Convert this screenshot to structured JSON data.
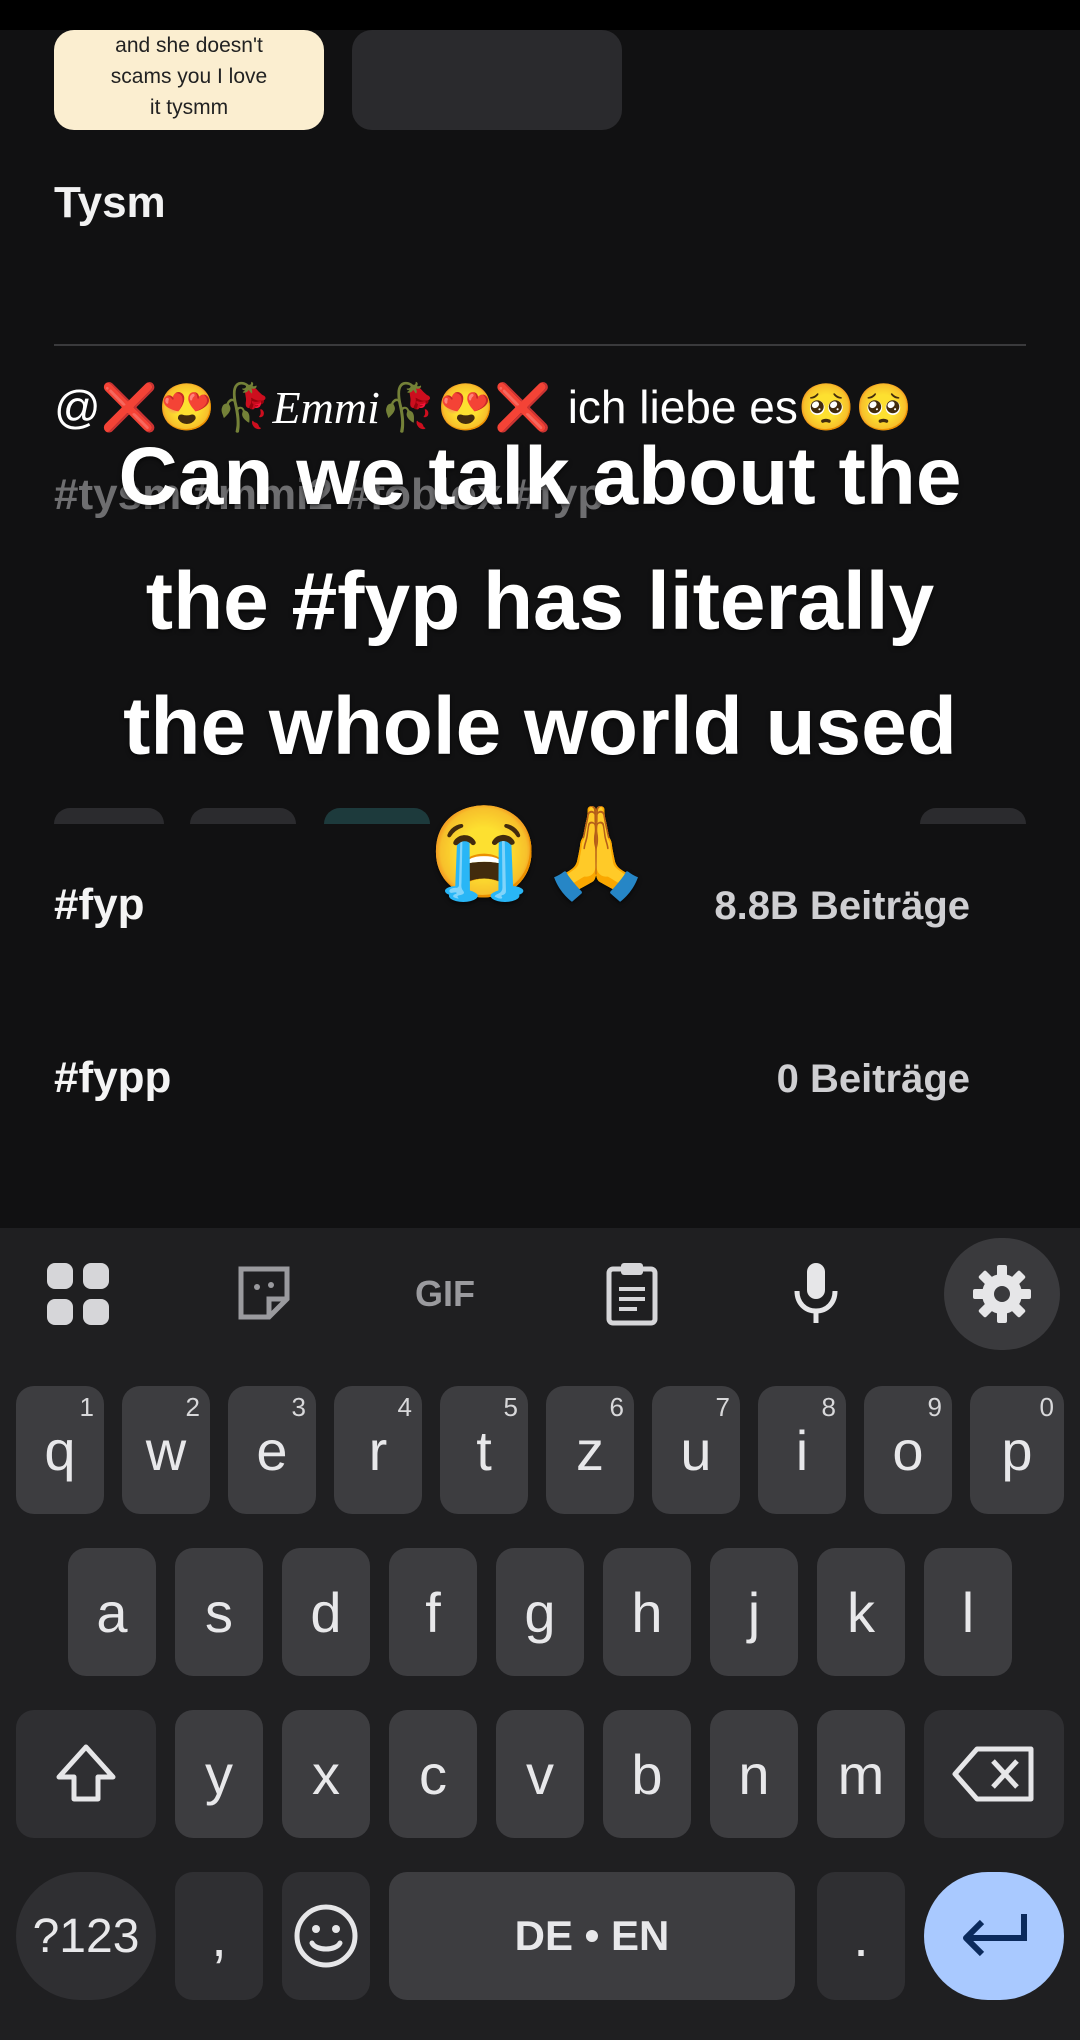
{
  "feed": {
    "card_text": [
      "and she doesn't",
      "scams you I love",
      "it tysmm"
    ],
    "caption": "Tysm",
    "comment_mention": "@❌😍🥀",
    "comment_name": "Emmi",
    "comment_mention_end": "🥀😍❌",
    "comment_text": "ich liebe es🥺🥺",
    "faint_hashtags": "#tysm #mmi2 #foblox #fyp"
  },
  "overlay_caption": {
    "line1": "Can we talk about the",
    "line2": "the #fyp has literally",
    "line3": "the whole world used",
    "line4": "😭🙏"
  },
  "hashtag_suggestions": [
    {
      "tag": "#fyp",
      "count": "8.8B Beiträge"
    },
    {
      "tag": "#fypp",
      "count": "0 Beiträge"
    }
  ],
  "keyboard": {
    "toolbar": [
      "apps-grid-icon",
      "sticker-icon",
      "GIF",
      "clipboard-icon",
      "microphone-icon",
      "gear-icon"
    ],
    "gif_label": "GIF",
    "row1": [
      {
        "key": "q",
        "num": "1"
      },
      {
        "key": "w",
        "num": "2"
      },
      {
        "key": "e",
        "num": "3"
      },
      {
        "key": "r",
        "num": "4"
      },
      {
        "key": "t",
        "num": "5"
      },
      {
        "key": "z",
        "num": "6"
      },
      {
        "key": "u",
        "num": "7"
      },
      {
        "key": "i",
        "num": "8"
      },
      {
        "key": "o",
        "num": "9"
      },
      {
        "key": "p",
        "num": "0"
      }
    ],
    "row2": [
      "a",
      "s",
      "d",
      "f",
      "g",
      "h",
      "j",
      "k",
      "l"
    ],
    "row3": [
      "y",
      "x",
      "c",
      "v",
      "b",
      "n",
      "m"
    ],
    "symbols_label": "?123",
    "comma_label": ",",
    "space_label": "DE • EN",
    "period_label": ".",
    "accent_color": "#a9c9ff"
  }
}
